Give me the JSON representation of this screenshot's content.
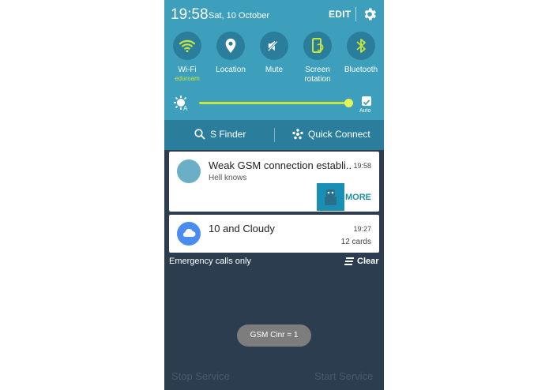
{
  "status": {
    "time": "19:58",
    "date": "Sat, 10 October",
    "edit": "EDIT"
  },
  "toggles": [
    {
      "label": "Wi-Fi",
      "sub": "eduroam"
    },
    {
      "label": "Location",
      "sub": ""
    },
    {
      "label": "Mute",
      "sub": ""
    },
    {
      "label": "Screen rotation",
      "sub": ""
    },
    {
      "label": "Bluetooth",
      "sub": ""
    }
  ],
  "brightness": {
    "auto_label": "Auto",
    "level": 0.97
  },
  "finder": {
    "s_finder": "S Finder",
    "quick_connect": "Quick Connect"
  },
  "notifications": [
    {
      "title": "Weak GSM connection establi..",
      "text": "Hell knows",
      "time": "19:58",
      "action": "MORE"
    },
    {
      "title": "10 and Cloudy",
      "time": "19:27",
      "count": "12 cards"
    }
  ],
  "footer": {
    "emergency": "Emergency calls only",
    "clear": "Clear"
  },
  "toast": "GSM Cinr = 1",
  "buttons": {
    "stop": "Stop Service",
    "start": "Start Service"
  },
  "colors": {
    "panel": "#3d9fbb",
    "accent": "#c8e63a",
    "background": "#2b3d4f"
  }
}
